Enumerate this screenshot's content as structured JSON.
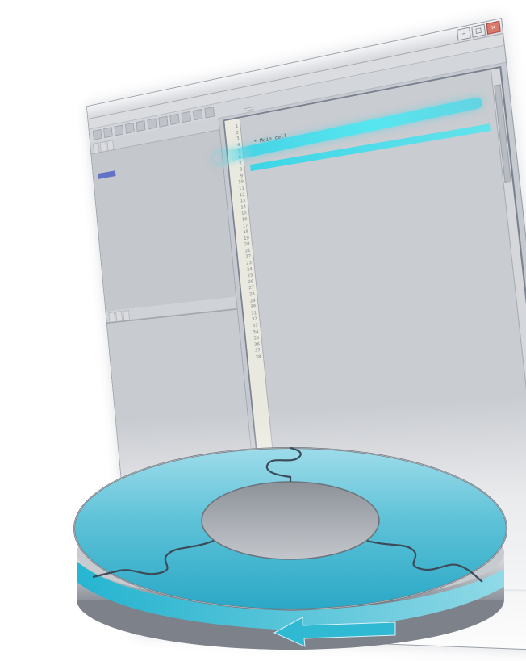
{
  "window": {
    "title": "",
    "menu": [
      "",
      "",
      "",
      "",
      "",
      "",
      "",
      ""
    ],
    "tabs_left": [
      "",
      "",
      ""
    ],
    "tabs_lower": [
      "",
      "",
      ""
    ],
    "editor_tab": "",
    "console_lines": [
      "",
      ""
    ],
    "controls": {
      "minimize": "–",
      "maximize": "□",
      "close": "×"
    }
  },
  "editor": {
    "gutter": [
      "1",
      "2",
      "3",
      "4",
      "5",
      "6",
      "7",
      "8",
      "9",
      "10",
      "11",
      "12",
      "13",
      "14",
      "15",
      "16",
      "17",
      "18",
      "19",
      "20",
      "21",
      "22",
      "23",
      "24",
      "25",
      "26",
      "27",
      "28",
      "29",
      "30",
      "31",
      "32",
      "33",
      "34",
      "35",
      "36",
      "37",
      "38"
    ],
    "lines": [
      "",
      "",
      "",
      "  * Main cell",
      "",
      "",
      "",
      "",
      "",
      "",
      "",
      "",
      "",
      "",
      "",
      "",
      "",
      "",
      "",
      "",
      "",
      "",
      "",
      "",
      "",
      "",
      "",
      "",
      "",
      "",
      "",
      "",
      "",
      "",
      "",
      "",
      "",
      ""
    ],
    "highlight_line": 7
  },
  "colors": {
    "accent": "#35d6e8",
    "disc_top": "#5fc4d8",
    "disc_side": "#a9adb4",
    "arrow": "#2fb9d3"
  },
  "icons": {
    "arrow": "arrow-left-icon"
  }
}
